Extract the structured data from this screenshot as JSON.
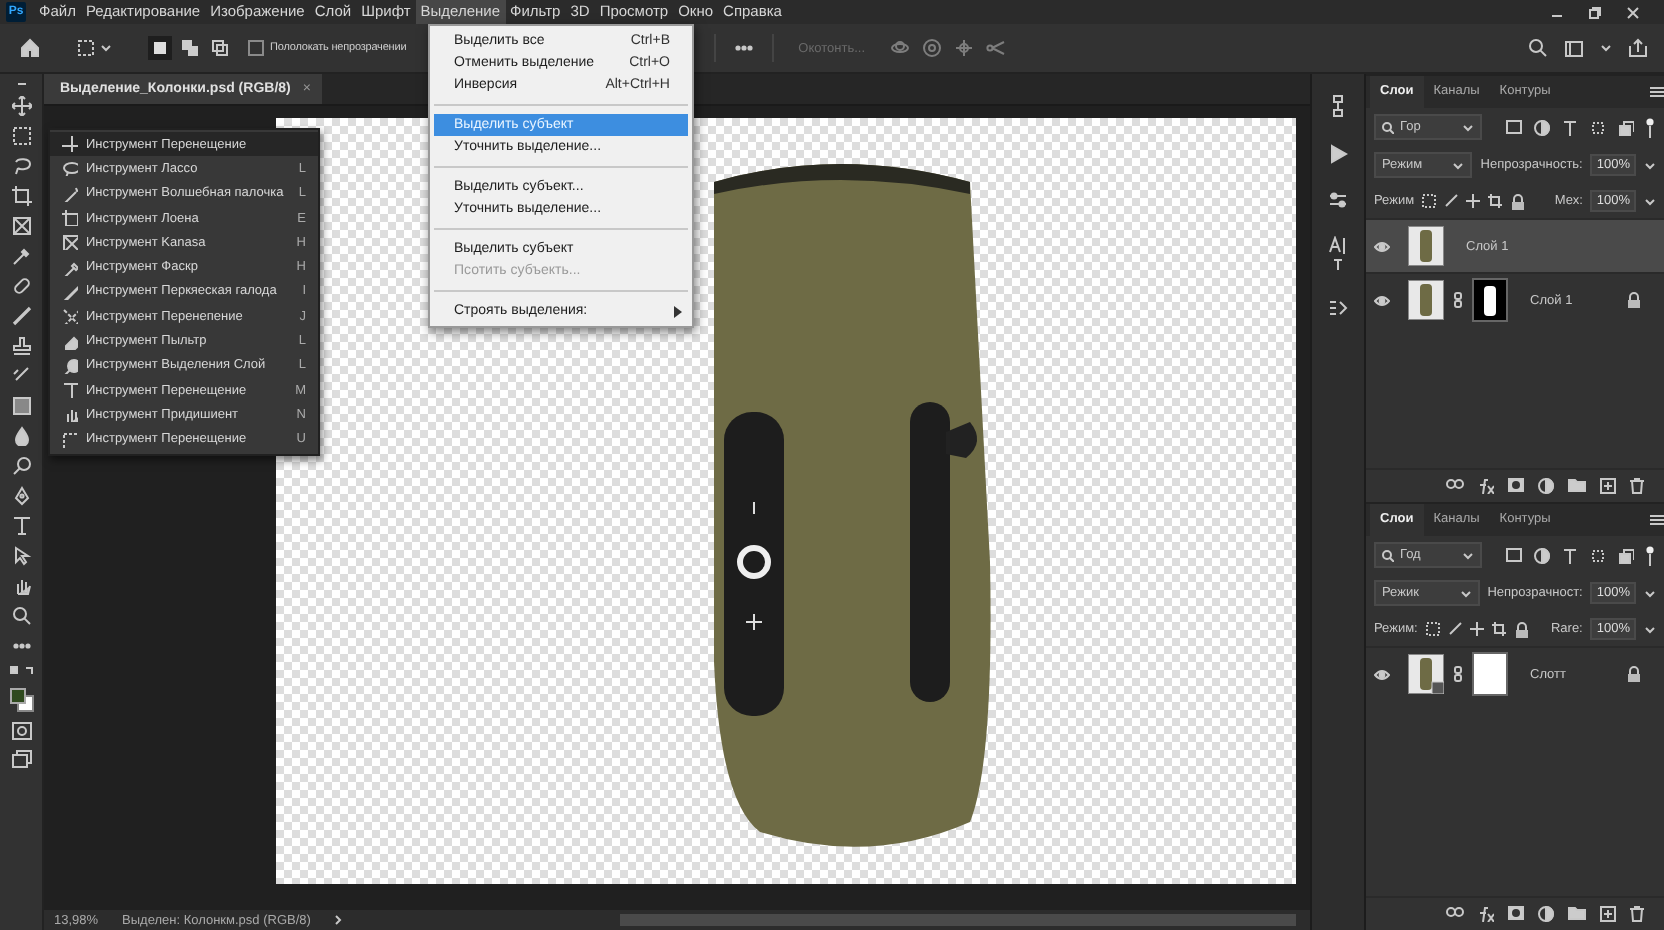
{
  "menubar": {
    "logo": "Ps",
    "items": [
      {
        "label": "Файл",
        "selected": false
      },
      {
        "label": "Редактирование",
        "selected": false
      },
      {
        "label": "Изображение",
        "selected": false
      },
      {
        "label": "Слой",
        "selected": false
      },
      {
        "label": "Шрифт",
        "selected": false
      },
      {
        "label": "Выделение",
        "selected": true
      },
      {
        "label": "Фильтр",
        "selected": false
      },
      {
        "label": "3D",
        "selected": false
      },
      {
        "label": "Просмотр",
        "selected": false
      },
      {
        "label": "Окно",
        "selected": false
      },
      {
        "label": "Справка",
        "selected": false
      }
    ]
  },
  "options_bar": {
    "modes": [
      {
        "selected": true
      },
      {
        "selected": false
      },
      {
        "selected": false
      }
    ],
    "checkbox": {
      "label": "Пололокать непрозрачении",
      "checked": false
    },
    "button": {
      "label": "Окотонть...",
      "disabled": true
    }
  },
  "document": {
    "tab": {
      "title": "Выделение_Колонки.psd (RGB/8)",
      "close": "×"
    }
  },
  "tool_flyout": {
    "items": [
      {
        "label": "Инструмент Перенещение",
        "selected": true
      },
      {
        "label": "Инструмент Лассо",
        "shortcut": "L",
        "selected": false
      },
      {
        "label": "Инструмент Волшебная палочка",
        "shortcut": "L",
        "selected": false
      },
      {
        "label": "Инструмент Лоена",
        "shortcut": "E",
        "selected": false
      },
      {
        "label": "Инструмент Kanasa",
        "shortcut": "H",
        "selected": false
      },
      {
        "label": "Инструмент Фаскр",
        "shortcut": "H",
        "selected": false
      },
      {
        "label": "Инструмент Перкяеская галода",
        "shortcut": "I",
        "selected": false
      },
      {
        "label": "Инструмент Перенепение",
        "shortcut": "J",
        "selected": false
      },
      {
        "label": "Инструмент Пыльтр",
        "shortcut": "L",
        "selected": false
      },
      {
        "label": "Инструмент Выделения Слой",
        "shortcut": "L",
        "selected": false
      },
      {
        "label": "Инструмент Перенещение",
        "shortcut": "M",
        "selected": false
      },
      {
        "label": "Инструмент Придишиент",
        "shortcut": "N",
        "selected": false
      },
      {
        "label": "Инструмент Перенещение",
        "shortcut": "U",
        "selected": false
      }
    ]
  },
  "select_menu": {
    "sections": [
      [
        {
          "label": "Выделить все",
          "shortcut": "Ctrl+B",
          "selected": false,
          "disabled": false,
          "submenu": false
        },
        {
          "label": "Отменить выделение",
          "shortcut": "Ctrl+O",
          "selected": false,
          "disabled": false,
          "submenu": false
        },
        {
          "label": "Инверсия",
          "shortcut": "Alt+Ctrl+H",
          "selected": false,
          "disabled": false,
          "submenu": false
        }
      ],
      [
        {
          "label": "Выделить субъект",
          "selected": true,
          "disabled": false,
          "submenu": false
        },
        {
          "label": "Уточнить выделение...",
          "selected": false,
          "disabled": false,
          "submenu": false
        }
      ],
      [
        {
          "label": "Выделить субъект...",
          "selected": false,
          "disabled": false,
          "submenu": false
        },
        {
          "label": "Уточнить выделение...",
          "selected": false,
          "disabled": false,
          "submenu": false
        }
      ],
      [
        {
          "label": "Выделить субъект",
          "selected": false,
          "disabled": false,
          "submenu": false
        },
        {
          "label": "Псотить субъекть...",
          "selected": false,
          "disabled": true,
          "submenu": false
        }
      ],
      [
        {
          "label": "Строять выделения:",
          "selected": false,
          "disabled": false,
          "submenu": true
        }
      ]
    ]
  },
  "panels": [
    {
      "tabs": [
        {
          "label": "Слои",
          "selected": true
        },
        {
          "label": "Каналы",
          "selected": false
        },
        {
          "label": "Контуры",
          "selected": false
        }
      ],
      "filter": "Гор",
      "blend_mode": "Режим",
      "opacity_label": "Непрозрачность:",
      "opacity": "100%",
      "lock_label": "Режим",
      "fill_label": "Мех:",
      "fill": "100%",
      "layers": [
        {
          "name": "Слой 1",
          "kind": "plain",
          "visible": true,
          "selected": true,
          "locked": false
        },
        {
          "name": "Слой 1",
          "kind": "masked",
          "visible": true,
          "selected": false,
          "locked": true
        }
      ]
    },
    {
      "tabs": [
        {
          "label": "Слои",
          "selected": true
        },
        {
          "label": "Каналы",
          "selected": false
        },
        {
          "label": "Контуры",
          "selected": false
        }
      ],
      "filter": "Год",
      "blend_mode": "Режик",
      "opacity_label": "Непрозрачност:",
      "opacity": "100%",
      "lock_label": "Режим:",
      "fill_label": "Rare:",
      "fill": "100%",
      "layers": [
        {
          "name": "Слотт",
          "kind": "smart",
          "visible": true,
          "selected": false,
          "locked": true
        }
      ]
    }
  ],
  "status_bar": {
    "zoom": "13,98%",
    "document_info": "Выделен: Колонкм.psd (RGB/8)"
  }
}
